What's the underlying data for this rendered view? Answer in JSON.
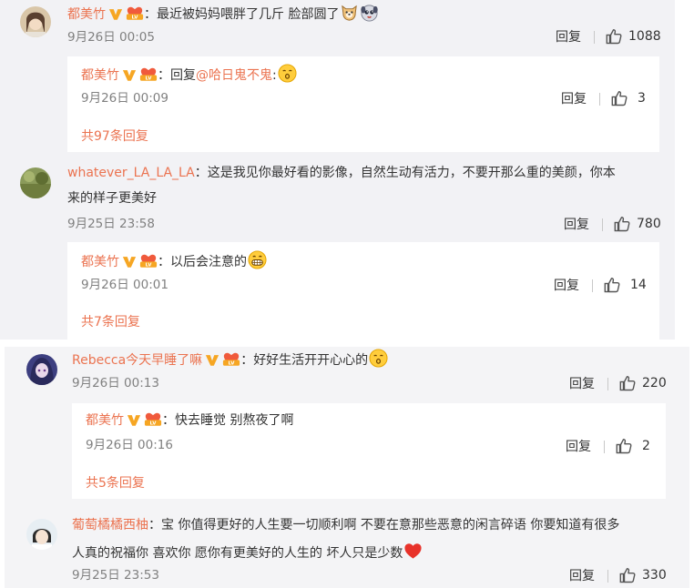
{
  "comments": [
    {
      "user": "都美竹",
      "sep": "：",
      "text": "最近被妈妈喂胖了几斤 脸部圆了",
      "time": "9月26日 00:05",
      "reply_label": "回复",
      "likes": "1088",
      "emoji": [
        "dog-face-icon",
        "puppy-face-icon"
      ],
      "reply": {
        "user": "都美竹",
        "sep": "：",
        "prefix": "回复",
        "mention": "@哈日鬼不鬼",
        "text": ":",
        "time": "9月26日 00:09",
        "reply_label": "回复",
        "likes": "3",
        "more": "共97条回复",
        "emoji": [
          "kissing-face-icon"
        ]
      }
    },
    {
      "user": "whatever_LA_LA_LA",
      "sep": "：",
      "text_line1": "这是我见你最好看的影像，自然生动有活力，不要开那么重的美颜，你本",
      "text_line2": "来的样子更美好",
      "time": "9月25日 23:58",
      "reply_label": "回复",
      "likes": "780",
      "reply": {
        "user": "都美竹",
        "sep": "：",
        "text": "以后会注意的",
        "time": "9月26日 00:01",
        "reply_label": "回复",
        "likes": "14",
        "more": "共7条回复",
        "emoji": [
          "grinning-face-icon"
        ]
      }
    },
    {
      "user": "Rebecca今天早睡了嘛",
      "sep": "：",
      "text": "好好生活开开心心的",
      "time": "9月26日 00:13",
      "reply_label": "回复",
      "likes": "220",
      "emoji": [
        "kissing-face-icon"
      ],
      "reply": {
        "user": "都美竹",
        "sep": "：",
        "text": "快去睡觉 别熬夜了啊",
        "time": "9月26日 00:16",
        "reply_label": "回复",
        "likes": "2",
        "more": "共5条回复"
      }
    },
    {
      "user": "葡萄橘橘西柚",
      "sep": "：",
      "text_line1": "宝 你值得更好的人生要一切顺利啊 不要在意那些恶意的闲言碎语 你要知道有很多",
      "text_line2": "人真的祝福你 喜欢你 愿你有更美好的人生的 坏人只是少数",
      "time": "9月25日 23:53",
      "reply_label": "回复",
      "likes": "330",
      "emoji": [
        "red-heart-icon"
      ]
    }
  ],
  "colors": {
    "username": "#eb7350",
    "text": "#333333",
    "timestamp": "#808080",
    "badge_gold": "#f6a623",
    "panel_bg": "#f2f2f5"
  }
}
